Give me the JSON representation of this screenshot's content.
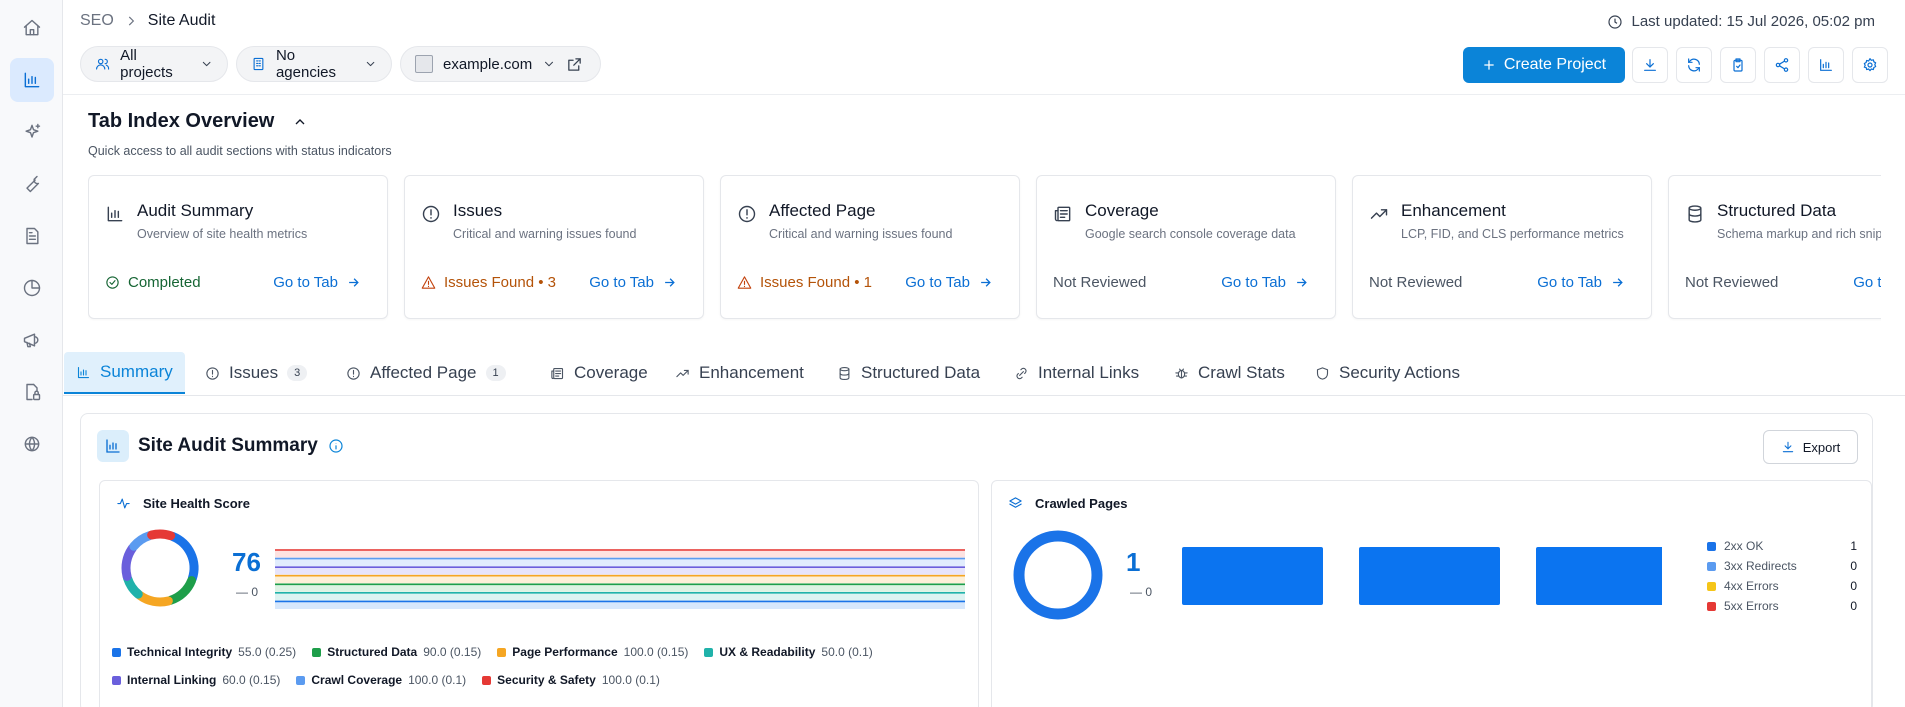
{
  "breadcrumb": {
    "root": "SEO",
    "current": "Site Audit"
  },
  "last_updated": "Last updated: 15 Jul 2026, 05:02 pm",
  "filters": {
    "projects": "All projects",
    "agencies": "No agencies",
    "domain": "example.com"
  },
  "actions": {
    "create_project": "Create Project"
  },
  "overview": {
    "title": "Tab Index Overview",
    "subtitle": "Quick access to all audit sections with status indicators",
    "cards": [
      {
        "title": "Audit Summary",
        "desc": "Overview of site health metrics",
        "status": "Completed",
        "status_kind": "ok",
        "go": "Go to Tab",
        "icon": "bar-chart-icon"
      },
      {
        "title": "Issues",
        "desc": "Critical and warning issues found",
        "status": "Issues Found • 3",
        "status_kind": "warn",
        "go": "Go to Tab",
        "icon": "alert-circle-icon"
      },
      {
        "title": "Affected Page",
        "desc": "Critical and warning issues found",
        "status": "Issues Found • 1",
        "status_kind": "warn",
        "go": "Go to Tab",
        "icon": "alert-circle-icon"
      },
      {
        "title": "Coverage",
        "desc": "Google search console coverage data",
        "status": "Not Reviewed",
        "status_kind": "none",
        "go": "Go to Tab",
        "icon": "newspaper-icon"
      },
      {
        "title": "Enhancement",
        "desc": "LCP, FID, and CLS performance metrics",
        "status": "Not Reviewed",
        "status_kind": "none",
        "go": "Go to Tab",
        "icon": "trending-up-icon"
      },
      {
        "title": "Structured Data",
        "desc": "Schema markup and rich snippets",
        "status": "Not Reviewed",
        "status_kind": "none",
        "go": "Go to Tab",
        "icon": "database-icon"
      }
    ]
  },
  "tabs": [
    {
      "label": "Summary",
      "count": "",
      "active": true,
      "icon": "bar-chart-icon"
    },
    {
      "label": "Issues",
      "count": "3",
      "icon": "alert-circle-icon"
    },
    {
      "label": "Affected Page",
      "count": "1",
      "icon": "alert-circle-icon"
    },
    {
      "label": "Coverage",
      "count": "",
      "icon": "newspaper-icon"
    },
    {
      "label": "Enhancement",
      "count": "",
      "icon": "trending-up-icon"
    },
    {
      "label": "Structured Data",
      "count": "",
      "icon": "database-icon"
    },
    {
      "label": "Internal Links",
      "count": "",
      "icon": "link-icon"
    },
    {
      "label": "Crawl Stats",
      "count": "",
      "icon": "bug-icon"
    },
    {
      "label": "Security Actions",
      "count": "",
      "icon": "shield-icon"
    }
  ],
  "summary": {
    "title": "Site Audit Summary",
    "export_label": "Export",
    "health": {
      "title": "Site Health Score",
      "score": "76",
      "delta": "— 0",
      "components": [
        {
          "name": "Technical Integrity",
          "value": "55.0 (0.25)",
          "color": "#1a73e8"
        },
        {
          "name": "Structured Data",
          "value": "90.0 (0.15)",
          "color": "#1e9e4a"
        },
        {
          "name": "Page Performance",
          "value": "100.0 (0.15)",
          "color": "#f5a623"
        },
        {
          "name": "UX & Readability",
          "value": "50.0 (0.1)",
          "color": "#20b2aa"
        },
        {
          "name": "Internal Linking",
          "value": "60.0 (0.15)",
          "color": "#6a5fdc"
        },
        {
          "name": "Crawl Coverage",
          "value": "100.0 (0.1)",
          "color": "#5b9bf0"
        },
        {
          "name": "Security & Safety",
          "value": "100.0 (0.1)",
          "color": "#e53935"
        }
      ]
    },
    "crawled": {
      "title": "Crawled Pages",
      "total": "1",
      "delta": "— 0",
      "statuses": [
        {
          "label": "2xx OK",
          "value": "1",
          "color": "#1a73e8"
        },
        {
          "label": "3xx Redirects",
          "value": "0",
          "color": "#5b9bf0"
        },
        {
          "label": "4xx Errors",
          "value": "0",
          "color": "#f5c518"
        },
        {
          "label": "5xx Errors",
          "value": "0",
          "color": "#e53935"
        }
      ]
    }
  }
}
